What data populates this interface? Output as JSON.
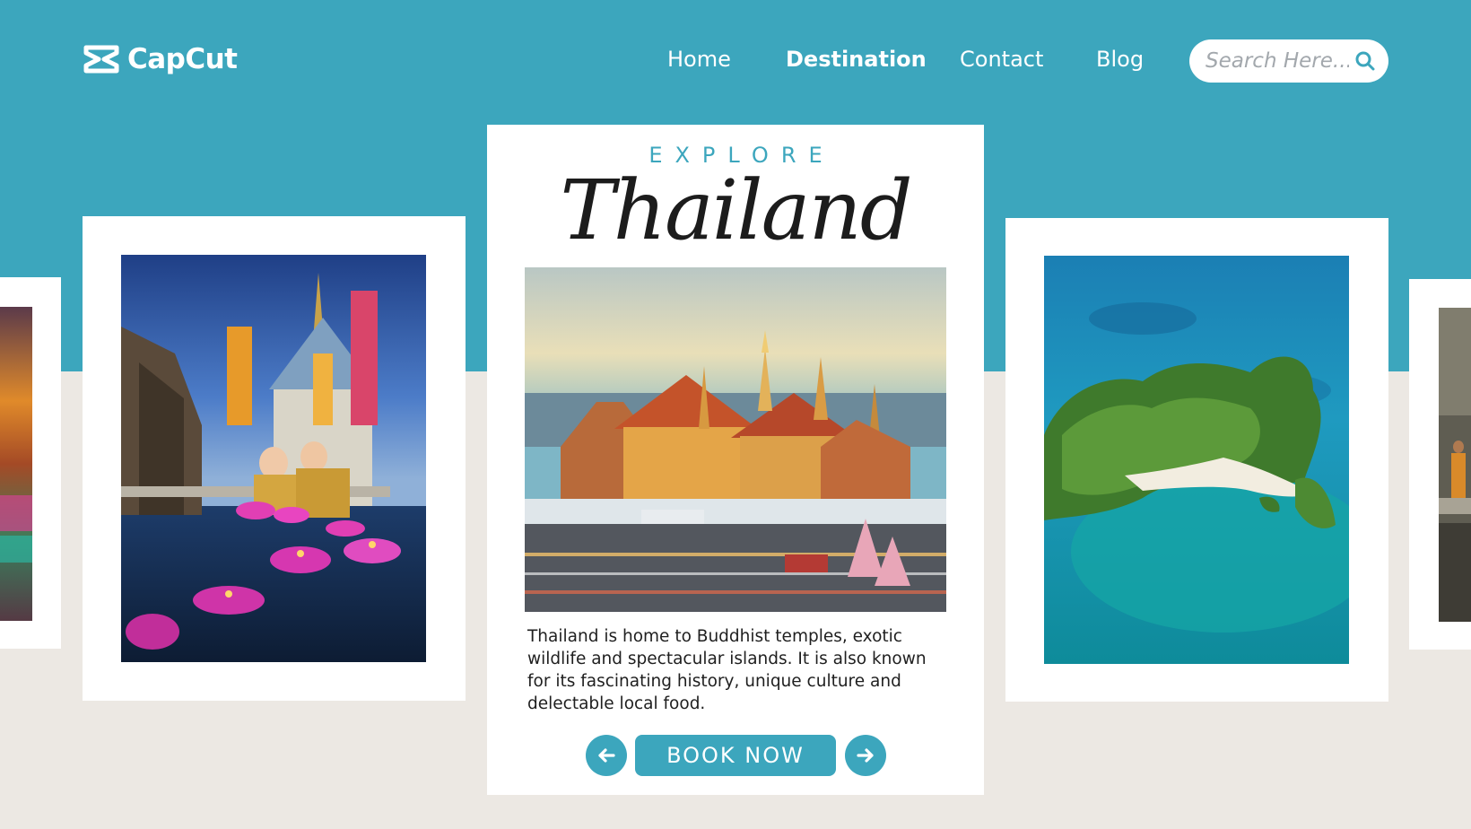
{
  "brand": {
    "name": "CapCut"
  },
  "nav": {
    "items": [
      {
        "label": "Home",
        "active": false
      },
      {
        "label": "Destination",
        "active": true
      },
      {
        "label": "Contact",
        "active": false
      },
      {
        "label": "Blog",
        "active": false
      }
    ]
  },
  "search": {
    "placeholder": "Search Here...",
    "icon": "search-icon"
  },
  "hero": {
    "eyebrow": "EXPLORE",
    "title": "Thailand",
    "description": "Thailand is home to Buddhist temples, exotic wildlife and spectacular islands. It is also known for its fascinating history, unique culture and delectable local food.",
    "book_label": "BOOK NOW",
    "prev_icon": "arrow-left-icon",
    "next_icon": "arrow-right-icon"
  },
  "colors": {
    "accent": "#3ca6bd",
    "background": "#ece8e3",
    "card": "#ffffff",
    "text": "#1f1f1f"
  }
}
